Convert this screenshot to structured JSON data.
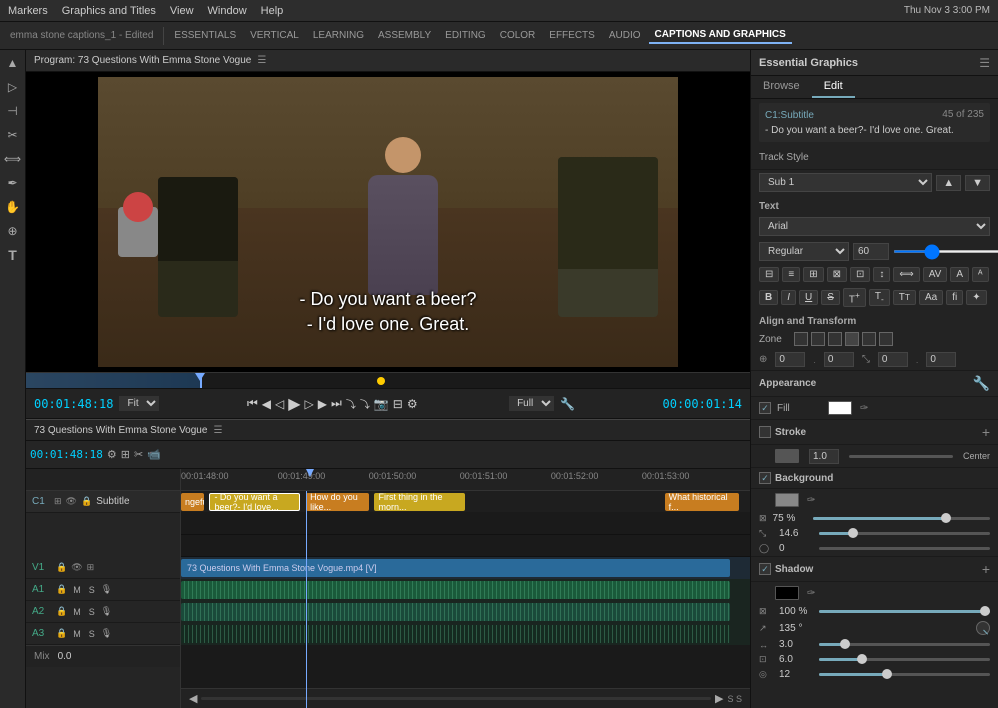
{
  "menubar": {
    "items": [
      "Markers",
      "Graphics and Titles",
      "View",
      "Window",
      "Help"
    ],
    "right": "Thu Nov 3  3:00 PM"
  },
  "toolbar": {
    "program_label": "Program: 73 Questions With Emma Stone  Vogue",
    "sequence_label": "emma stone captions_1 - Edited",
    "tabs": [
      "ESSENTIALS",
      "VERTICAL",
      "LEARNING",
      "ASSEMBLY",
      "EDITING",
      "COLOR",
      "EFFECTS",
      "AUDIO",
      "CAPTIONS AND GRAPHICS"
    ]
  },
  "monitor": {
    "title": "Program: 73 Questions With Emma Stone  Vogue",
    "subtitle_line1": "- Do you want a beer?",
    "subtitle_line2": "- I'd love one. Great.",
    "time_current": "00:01:48:18",
    "fit_label": "Fit",
    "time_total": "00:00:01:14",
    "fit_value": "Full"
  },
  "timeline": {
    "title": "73 Questions With Emma Stone  Vogue",
    "current_time": "00:01:48:18",
    "mix_label": "Mix",
    "mix_value": "0.0",
    "ruler_times": [
      "00:01:48:00",
      "00:01:49:00",
      "00:01:50:00",
      "00:01:51:00",
      "00:01:52:00",
      "00:01:53:00"
    ],
    "tracks": [
      {
        "id": "C1",
        "name": "Subtitle",
        "type": "subtitle"
      },
      {
        "id": "V1",
        "name": "",
        "type": "video"
      },
      {
        "id": "A1",
        "name": "",
        "type": "audio"
      },
      {
        "id": "A2",
        "name": "",
        "type": "audio"
      },
      {
        "id": "A3",
        "name": "",
        "type": "audio"
      }
    ],
    "clips": [
      {
        "label": "ngeful.",
        "type": "orange",
        "left": "0%",
        "width": "5%"
      },
      {
        "label": "- Do you want a beer?- I'd love...",
        "type": "yellow",
        "left": "5%",
        "width": "17%"
      },
      {
        "label": "How do you like...",
        "type": "orange",
        "left": "22%",
        "width": "12%"
      },
      {
        "label": "First thing in the morn...",
        "type": "yellow",
        "left": "34%",
        "width": "18%"
      },
      {
        "label": "What historical f...",
        "type": "orange",
        "left": "86%",
        "width": "12%"
      }
    ],
    "video_clip": "73 Questions With Emma Stone  Vogue.mp4 [V]",
    "audio_clip": ""
  },
  "essential_graphics": {
    "panel_title": "Essential Graphics",
    "browse_tab": "Browse",
    "edit_tab": "Edit",
    "subtitle_name": "C1:Subtitle",
    "subtitle_count": "45 of 235",
    "subtitle_text": "- Do you want a beer?- I'd love one. Great.",
    "track_style_label": "Track Style",
    "track_style_value": "Sub 1",
    "text_section": "Text",
    "font_value": "Arial",
    "font_style": "Regular",
    "font_size": "60",
    "align_section": "Align and Transform",
    "zone_label": "Zone",
    "zone_x": "0",
    "zone_y": "0",
    "zone_w": "0",
    "zone_h": "0",
    "appearance_section": "Appearance",
    "fill_label": "Fill",
    "fill_checked": true,
    "fill_color": "#ffffff",
    "stroke_label": "Stroke",
    "stroke_checked": false,
    "stroke_color": "#555555",
    "stroke_value": "1.0",
    "stroke_extra": "Center",
    "background_label": "Background",
    "background_checked": true,
    "background_color": "#888888",
    "bg_opacity_label": "75 %",
    "bg_val1": "14.6",
    "bg_val2": "0",
    "bg_val3": "0",
    "shadow_label": "Shadow",
    "shadow_checked": true,
    "shadow_color": "#000000",
    "shadow_opacity": "100 %",
    "shadow_angle": "135 °",
    "shadow_val1": "3.0",
    "shadow_val2": "6.0",
    "shadow_val3": "12"
  },
  "icons": {
    "menu_triangle": "☰",
    "wrench": "🔧",
    "play": "▶",
    "pause": "⏸",
    "step_back": "⏮",
    "step_fwd": "⏭",
    "rewind": "◀◀",
    "ff": "▶▶",
    "add": "+",
    "close": "✕",
    "chevron_down": "▾",
    "chevron_right": "▸",
    "settings": "⚙",
    "bold": "B",
    "italic": "I",
    "underline": "U",
    "strikethrough": "S",
    "superscript": "^",
    "subscript": "_",
    "tsm": "T",
    "tsmall": "T"
  }
}
